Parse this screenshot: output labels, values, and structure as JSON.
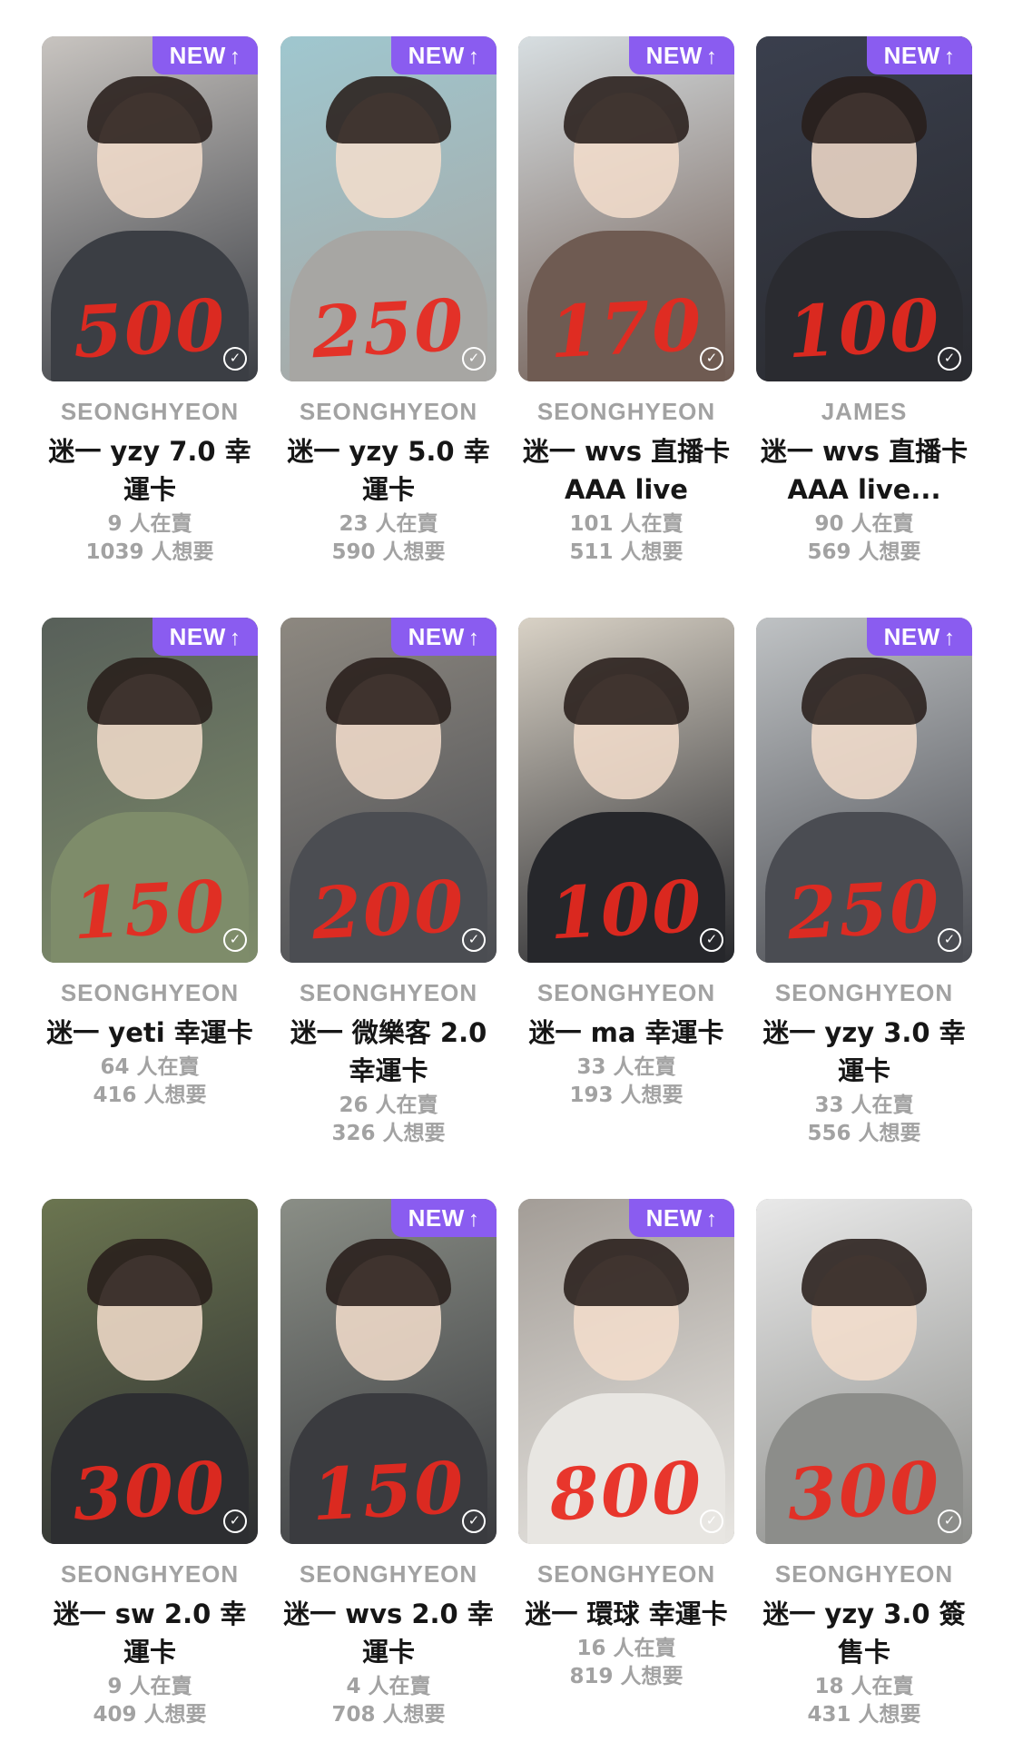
{
  "badge": {
    "label": "NEW",
    "arrow": "↑"
  },
  "check_icon": "check-circle-icon",
  "colors": {
    "badge": "#8a5cf0",
    "price_mark": "#e8291f",
    "member": "#a2a2a2",
    "title": "#161616",
    "stats": "#a2a2a2"
  },
  "cards": [
    {
      "member": "SEONGHYEON",
      "title": "迷一 yzy 7.0 幸運卡",
      "sellers": "9 人在賣",
      "wanted": "1039 人想要",
      "price_mark": "500",
      "is_new": true,
      "palette": [
        "#c8c4c0",
        "#3b3e44"
      ]
    },
    {
      "member": "SEONGHYEON",
      "title": "迷一 yzy 5.0 幸運卡",
      "sellers": "23 人在賣",
      "wanted": "590 人想要",
      "price_mark": "250",
      "is_new": true,
      "palette": [
        "#9fc7cf",
        "#a7a6a3"
      ]
    },
    {
      "member": "SEONGHYEON",
      "title": "迷一 wvs 直播卡 AAA live",
      "sellers": "101 人在賣",
      "wanted": "511 人想要",
      "price_mark": "170",
      "is_new": true,
      "palette": [
        "#d7dee1",
        "#6f5b52"
      ]
    },
    {
      "member": "JAMES",
      "title": "迷一 wvs 直播卡 AAA live...",
      "sellers": "90 人在賣",
      "wanted": "569 人想要",
      "price_mark": "100",
      "is_new": true,
      "palette": [
        "#3a3f4d",
        "#2a2b30"
      ]
    },
    {
      "member": "SEONGHYEON",
      "title": "迷一 yeti 幸運卡",
      "sellers": "64 人在賣",
      "wanted": "416 人想要",
      "price_mark": "150",
      "is_new": true,
      "palette": [
        "#58605a",
        "#7e8c6a"
      ]
    },
    {
      "member": "SEONGHYEON",
      "title": "迷一 微樂客 2.0 幸運卡",
      "sellers": "26 人在賣",
      "wanted": "326 人想要",
      "price_mark": "200",
      "is_new": true,
      "palette": [
        "#8d8880",
        "#4b4d52"
      ]
    },
    {
      "member": "SEONGHYEON",
      "title": "迷一 ma 幸運卡",
      "sellers": "33 人在賣",
      "wanted": "193 人想要",
      "price_mark": "100",
      "is_new": false,
      "palette": [
        "#d9d2c6",
        "#26272b"
      ]
    },
    {
      "member": "SEONGHYEON",
      "title": "迷一 yzy 3.0 幸運卡",
      "sellers": "33 人在賣",
      "wanted": "556 人想要",
      "price_mark": "250",
      "is_new": true,
      "palette": [
        "#bfc2c4",
        "#4a4c52"
      ]
    },
    {
      "member": "SEONGHYEON",
      "title": "迷一 sw 2.0 幸運卡",
      "sellers": "9 人在賣",
      "wanted": "409 人想要",
      "price_mark": "300",
      "is_new": false,
      "palette": [
        "#6b7550",
        "#2d2e31"
      ]
    },
    {
      "member": "SEONGHYEON",
      "title": "迷一 wvs 2.0 幸運卡",
      "sellers": "4 人在賣",
      "wanted": "708 人想要",
      "price_mark": "150",
      "is_new": true,
      "palette": [
        "#8a8e86",
        "#3a3b3f"
      ]
    },
    {
      "member": "SEONGHYEON",
      "title": "迷一 環球 幸運卡",
      "sellers": "16 人在賣",
      "wanted": "819 人想要",
      "price_mark": "800",
      "is_new": true,
      "palette": [
        "#a39d97",
        "#e8e6e2"
      ]
    },
    {
      "member": "SEONGHYEON",
      "title": "迷一 yzy 3.0 簽售卡",
      "sellers": "18 人在賣",
      "wanted": "431 人想要",
      "price_mark": "300",
      "is_new": false,
      "palette": [
        "#e9e9e9",
        "#8c8d8a"
      ]
    }
  ]
}
